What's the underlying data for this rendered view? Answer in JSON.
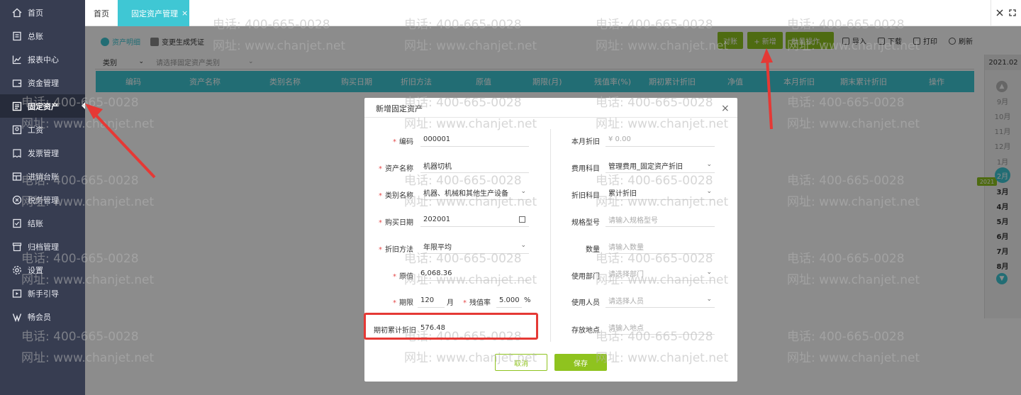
{
  "sidebar": {
    "items": [
      {
        "label": "首页",
        "icon": "home-icon"
      },
      {
        "label": "总账",
        "icon": "ledger-icon"
      },
      {
        "label": "报表中心",
        "icon": "chart-icon"
      },
      {
        "label": "资金管理",
        "icon": "wallet-icon"
      },
      {
        "label": "固定资产",
        "icon": "asset-icon"
      },
      {
        "label": "工资",
        "icon": "salary-icon"
      },
      {
        "label": "发票管理",
        "icon": "invoice-icon"
      },
      {
        "label": "进销台账",
        "icon": "stock-icon"
      },
      {
        "label": "税务管理",
        "icon": "tax-icon"
      },
      {
        "label": "结账",
        "icon": "close-book-icon"
      },
      {
        "label": "归档管理",
        "icon": "archive-icon"
      },
      {
        "label": "设置",
        "icon": "gear-icon"
      },
      {
        "label": "新手引导",
        "icon": "guide-icon"
      },
      {
        "label": "畅会员",
        "icon": "member-icon"
      }
    ],
    "active_index": 4
  },
  "tabs": {
    "home": "首页",
    "active": "固定资产管理",
    "close": "×"
  },
  "toolbar": {
    "subtab_detail": "资产明细",
    "subtab_voucher": "变更生成凭证",
    "reconcile": "对账",
    "add": "+ 新增",
    "batch": "批量操作 ⌄",
    "import": "导入",
    "download": "下载",
    "print": "打印",
    "refresh": "刷新"
  },
  "filter": {
    "category_label": "类别",
    "category_placeholder": "请选择固定资产类别"
  },
  "table": {
    "columns": [
      "编码",
      "资产名称",
      "类别名称",
      "购买日期",
      "折旧方法",
      "原值",
      "期限(月)",
      "残值率(%)",
      "期初累计折旧",
      "净值",
      "本月折旧",
      "期末累计折旧",
      "操作"
    ]
  },
  "year_panel": {
    "year": "2021.02",
    "badge": "2021",
    "months_prev": [
      "9月",
      "10月",
      "11月",
      "12月",
      "1月"
    ],
    "current": "2月",
    "months_next": [
      "3月",
      "4月",
      "5月",
      "6月",
      "7月",
      "8月"
    ]
  },
  "watermark": {
    "phone": "电话: 400-665-0028",
    "site": "网址: www.chanjet.net"
  },
  "modal": {
    "title": "新增固定资产",
    "close": "×",
    "left": {
      "code_label": "编码",
      "code_value": "000001",
      "name_label": "资产名称",
      "name_value": "机器切机",
      "category_label": "类别名称",
      "category_value": "机器、机械和其他生产设备",
      "date_label": "购买日期",
      "date_value": "202001",
      "method_label": "折旧方法",
      "method_value": "年限平均",
      "orig_label": "原值",
      "orig_value": "6,068.36",
      "term_label": "期限",
      "term_value": "120",
      "term_unit": "月",
      "residual_label": "残值率",
      "residual_value": "5.000",
      "residual_unit": "%",
      "opening_label": "期初累计折旧",
      "opening_value": "576.48"
    },
    "right": {
      "month_dep_label": "本月折旧",
      "month_dep_value": "¥ 0.00",
      "expense_label": "费用科目",
      "expense_value": "管理费用_固定资产折旧",
      "dep_subject_label": "折旧科目",
      "dep_subject_value": "累计折旧",
      "spec_label": "规格型号",
      "spec_placeholder": "请输入规格型号",
      "qty_label": "数量",
      "qty_placeholder": "请输入数量",
      "dept_label": "使用部门",
      "dept_placeholder": "请选择部门",
      "user_label": "使用人员",
      "user_placeholder": "请选择人员",
      "location_label": "存放地点",
      "location_placeholder": "请输入地点"
    },
    "cancel": "取消",
    "save": "保存"
  },
  "colors": {
    "accent": "#3fc7d4",
    "green": "#8fc31f",
    "sidebar": "#373d51",
    "annotation": "#e53935"
  }
}
